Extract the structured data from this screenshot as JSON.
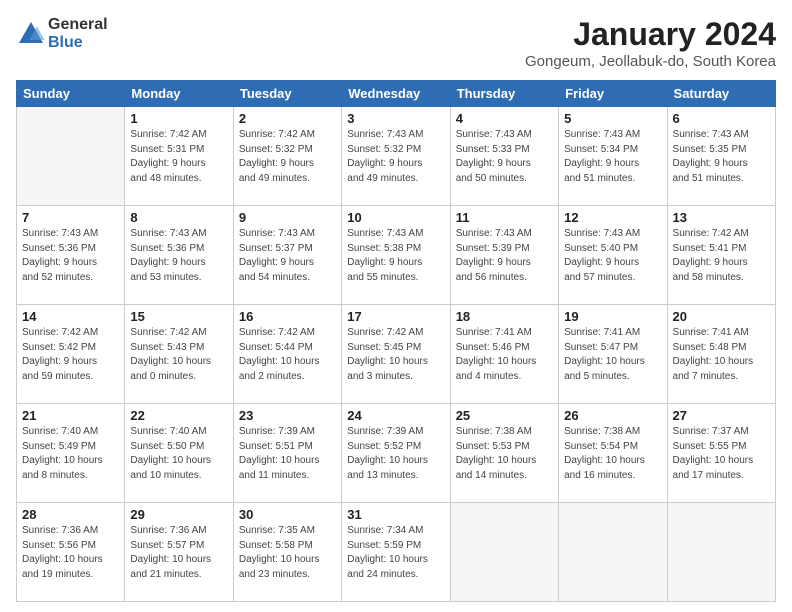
{
  "logo": {
    "general": "General",
    "blue": "Blue"
  },
  "header": {
    "title": "January 2024",
    "subtitle": "Gongeum, Jeollabuk-do, South Korea"
  },
  "days_of_week": [
    "Sunday",
    "Monday",
    "Tuesday",
    "Wednesday",
    "Thursday",
    "Friday",
    "Saturday"
  ],
  "weeks": [
    [
      {
        "day": "",
        "info": ""
      },
      {
        "day": "1",
        "info": "Sunrise: 7:42 AM\nSunset: 5:31 PM\nDaylight: 9 hours\nand 48 minutes."
      },
      {
        "day": "2",
        "info": "Sunrise: 7:42 AM\nSunset: 5:32 PM\nDaylight: 9 hours\nand 49 minutes."
      },
      {
        "day": "3",
        "info": "Sunrise: 7:43 AM\nSunset: 5:32 PM\nDaylight: 9 hours\nand 49 minutes."
      },
      {
        "day": "4",
        "info": "Sunrise: 7:43 AM\nSunset: 5:33 PM\nDaylight: 9 hours\nand 50 minutes."
      },
      {
        "day": "5",
        "info": "Sunrise: 7:43 AM\nSunset: 5:34 PM\nDaylight: 9 hours\nand 51 minutes."
      },
      {
        "day": "6",
        "info": "Sunrise: 7:43 AM\nSunset: 5:35 PM\nDaylight: 9 hours\nand 51 minutes."
      }
    ],
    [
      {
        "day": "7",
        "info": "Sunrise: 7:43 AM\nSunset: 5:36 PM\nDaylight: 9 hours\nand 52 minutes."
      },
      {
        "day": "8",
        "info": "Sunrise: 7:43 AM\nSunset: 5:36 PM\nDaylight: 9 hours\nand 53 minutes."
      },
      {
        "day": "9",
        "info": "Sunrise: 7:43 AM\nSunset: 5:37 PM\nDaylight: 9 hours\nand 54 minutes."
      },
      {
        "day": "10",
        "info": "Sunrise: 7:43 AM\nSunset: 5:38 PM\nDaylight: 9 hours\nand 55 minutes."
      },
      {
        "day": "11",
        "info": "Sunrise: 7:43 AM\nSunset: 5:39 PM\nDaylight: 9 hours\nand 56 minutes."
      },
      {
        "day": "12",
        "info": "Sunrise: 7:43 AM\nSunset: 5:40 PM\nDaylight: 9 hours\nand 57 minutes."
      },
      {
        "day": "13",
        "info": "Sunrise: 7:42 AM\nSunset: 5:41 PM\nDaylight: 9 hours\nand 58 minutes."
      }
    ],
    [
      {
        "day": "14",
        "info": "Sunrise: 7:42 AM\nSunset: 5:42 PM\nDaylight: 9 hours\nand 59 minutes."
      },
      {
        "day": "15",
        "info": "Sunrise: 7:42 AM\nSunset: 5:43 PM\nDaylight: 10 hours\nand 0 minutes."
      },
      {
        "day": "16",
        "info": "Sunrise: 7:42 AM\nSunset: 5:44 PM\nDaylight: 10 hours\nand 2 minutes."
      },
      {
        "day": "17",
        "info": "Sunrise: 7:42 AM\nSunset: 5:45 PM\nDaylight: 10 hours\nand 3 minutes."
      },
      {
        "day": "18",
        "info": "Sunrise: 7:41 AM\nSunset: 5:46 PM\nDaylight: 10 hours\nand 4 minutes."
      },
      {
        "day": "19",
        "info": "Sunrise: 7:41 AM\nSunset: 5:47 PM\nDaylight: 10 hours\nand 5 minutes."
      },
      {
        "day": "20",
        "info": "Sunrise: 7:41 AM\nSunset: 5:48 PM\nDaylight: 10 hours\nand 7 minutes."
      }
    ],
    [
      {
        "day": "21",
        "info": "Sunrise: 7:40 AM\nSunset: 5:49 PM\nDaylight: 10 hours\nand 8 minutes."
      },
      {
        "day": "22",
        "info": "Sunrise: 7:40 AM\nSunset: 5:50 PM\nDaylight: 10 hours\nand 10 minutes."
      },
      {
        "day": "23",
        "info": "Sunrise: 7:39 AM\nSunset: 5:51 PM\nDaylight: 10 hours\nand 11 minutes."
      },
      {
        "day": "24",
        "info": "Sunrise: 7:39 AM\nSunset: 5:52 PM\nDaylight: 10 hours\nand 13 minutes."
      },
      {
        "day": "25",
        "info": "Sunrise: 7:38 AM\nSunset: 5:53 PM\nDaylight: 10 hours\nand 14 minutes."
      },
      {
        "day": "26",
        "info": "Sunrise: 7:38 AM\nSunset: 5:54 PM\nDaylight: 10 hours\nand 16 minutes."
      },
      {
        "day": "27",
        "info": "Sunrise: 7:37 AM\nSunset: 5:55 PM\nDaylight: 10 hours\nand 17 minutes."
      }
    ],
    [
      {
        "day": "28",
        "info": "Sunrise: 7:36 AM\nSunset: 5:56 PM\nDaylight: 10 hours\nand 19 minutes."
      },
      {
        "day": "29",
        "info": "Sunrise: 7:36 AM\nSunset: 5:57 PM\nDaylight: 10 hours\nand 21 minutes."
      },
      {
        "day": "30",
        "info": "Sunrise: 7:35 AM\nSunset: 5:58 PM\nDaylight: 10 hours\nand 23 minutes."
      },
      {
        "day": "31",
        "info": "Sunrise: 7:34 AM\nSunset: 5:59 PM\nDaylight: 10 hours\nand 24 minutes."
      },
      {
        "day": "",
        "info": ""
      },
      {
        "day": "",
        "info": ""
      },
      {
        "day": "",
        "info": ""
      }
    ]
  ]
}
